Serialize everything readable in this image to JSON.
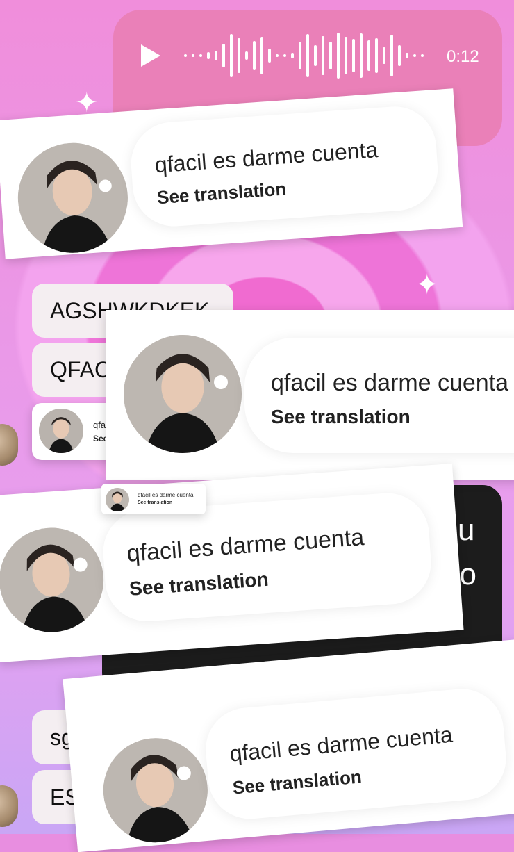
{
  "voice_message": {
    "duration": "0:12",
    "play_icon": "play-icon"
  },
  "reply": {
    "message": "qfacil es darme cuenta",
    "translate_label": "See translation"
  },
  "background_messages": [
    {
      "text": "AGSHWKDKEK"
    },
    {
      "text": "QFAC"
    },
    {
      "text": "sg"
    },
    {
      "text": "EST"
    }
  ],
  "mini_card_message": "qfa",
  "mini_card_translate": "See",
  "dark_message": {
    "line1": "su",
    "line2": "go"
  },
  "colors": {
    "voice_bubble": "#ea80b8",
    "background": "#f08edb",
    "dark_bubble": "#1c1c1c"
  }
}
